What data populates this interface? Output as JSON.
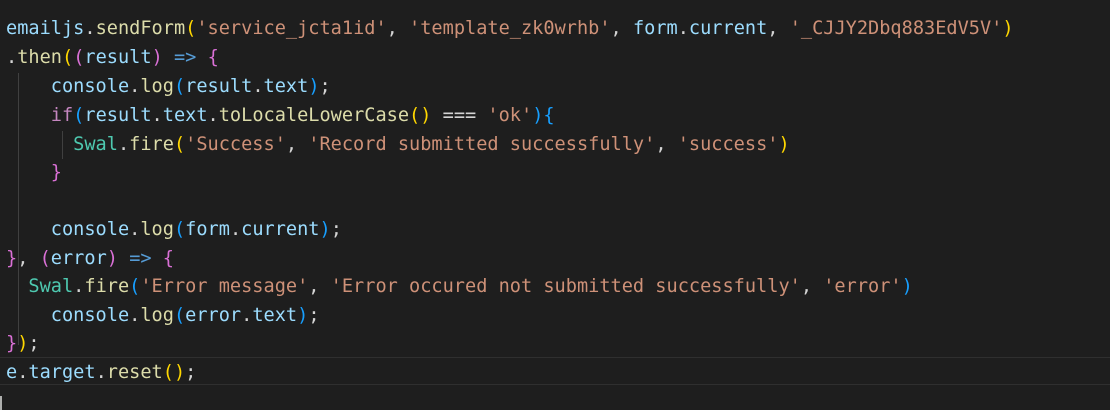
{
  "editor": {
    "lines": [
      {
        "tokens": [
          {
            "text": "emailjs",
            "cls": "tok-var"
          },
          {
            "text": ".",
            "cls": "tok-op"
          },
          {
            "text": "sendForm",
            "cls": "tok-fn"
          },
          {
            "text": "(",
            "cls": "b1"
          },
          {
            "text": "'service_jcta1id'",
            "cls": "tok-str"
          },
          {
            "text": ", ",
            "cls": "tok-op"
          },
          {
            "text": "'template_zk0wrhb'",
            "cls": "tok-str"
          },
          {
            "text": ", ",
            "cls": "tok-op"
          },
          {
            "text": "form",
            "cls": "tok-var"
          },
          {
            "text": ".",
            "cls": "tok-op"
          },
          {
            "text": "current",
            "cls": "tok-var"
          },
          {
            "text": ", ",
            "cls": "tok-op"
          },
          {
            "text": "'_CJJY2Dbq883EdV5V'",
            "cls": "tok-str"
          },
          {
            "text": ")",
            "cls": "b1"
          }
        ]
      },
      {
        "tokens": [
          {
            "text": ".",
            "cls": "tok-op"
          },
          {
            "text": "then",
            "cls": "tok-fn"
          },
          {
            "text": "(",
            "cls": "b1"
          },
          {
            "text": "(",
            "cls": "b2"
          },
          {
            "text": "result",
            "cls": "tok-var"
          },
          {
            "text": ")",
            "cls": "b2"
          },
          {
            "text": " ",
            "cls": "tok-op"
          },
          {
            "text": "=>",
            "cls": "tok-arrow"
          },
          {
            "text": " ",
            "cls": "tok-op"
          },
          {
            "text": "{",
            "cls": "b2"
          }
        ]
      },
      {
        "tokens": [
          {
            "text": "    ",
            "cls": "tok-op"
          },
          {
            "text": "console",
            "cls": "tok-var"
          },
          {
            "text": ".",
            "cls": "tok-op"
          },
          {
            "text": "log",
            "cls": "tok-fn"
          },
          {
            "text": "(",
            "cls": "b3"
          },
          {
            "text": "result",
            "cls": "tok-var"
          },
          {
            "text": ".",
            "cls": "tok-op"
          },
          {
            "text": "text",
            "cls": "tok-var"
          },
          {
            "text": ")",
            "cls": "b3"
          },
          {
            "text": ";",
            "cls": "tok-op"
          }
        ]
      },
      {
        "tokens": [
          {
            "text": "    ",
            "cls": "tok-op"
          },
          {
            "text": "if",
            "cls": "tok-kw"
          },
          {
            "text": "(",
            "cls": "b3"
          },
          {
            "text": "result",
            "cls": "tok-var"
          },
          {
            "text": ".",
            "cls": "tok-op"
          },
          {
            "text": "text",
            "cls": "tok-var"
          },
          {
            "text": ".",
            "cls": "tok-op"
          },
          {
            "text": "toLocaleLowerCase",
            "cls": "tok-fn"
          },
          {
            "text": "()",
            "cls": "b1"
          },
          {
            "text": " === ",
            "cls": "tok-op"
          },
          {
            "text": "'ok'",
            "cls": "tok-str"
          },
          {
            "text": ")",
            "cls": "b3"
          },
          {
            "text": "{",
            "cls": "b3"
          }
        ]
      },
      {
        "tokens": [
          {
            "text": "      ",
            "cls": "tok-op"
          },
          {
            "text": "Swal",
            "cls": "tok-cls"
          },
          {
            "text": ".",
            "cls": "tok-op"
          },
          {
            "text": "fire",
            "cls": "tok-fn"
          },
          {
            "text": "(",
            "cls": "b1"
          },
          {
            "text": "'Success'",
            "cls": "tok-str"
          },
          {
            "text": ", ",
            "cls": "tok-op"
          },
          {
            "text": "'Record submitted successfully'",
            "cls": "tok-str"
          },
          {
            "text": ", ",
            "cls": "tok-op"
          },
          {
            "text": "'success'",
            "cls": "tok-str"
          },
          {
            "text": ")",
            "cls": "b1"
          }
        ]
      },
      {
        "tokens": [
          {
            "text": "    ",
            "cls": "tok-op"
          },
          {
            "text": "}",
            "cls": "b2"
          }
        ]
      },
      {
        "tokens": []
      },
      {
        "tokens": [
          {
            "text": "    ",
            "cls": "tok-op"
          },
          {
            "text": "console",
            "cls": "tok-var"
          },
          {
            "text": ".",
            "cls": "tok-op"
          },
          {
            "text": "log",
            "cls": "tok-fn"
          },
          {
            "text": "(",
            "cls": "b3"
          },
          {
            "text": "form",
            "cls": "tok-var"
          },
          {
            "text": ".",
            "cls": "tok-op"
          },
          {
            "text": "current",
            "cls": "tok-var"
          },
          {
            "text": ")",
            "cls": "b3"
          },
          {
            "text": ";",
            "cls": "tok-op"
          }
        ]
      },
      {
        "tokens": [
          {
            "text": "}",
            "cls": "b2"
          },
          {
            "text": ", ",
            "cls": "tok-op"
          },
          {
            "text": "(",
            "cls": "b2"
          },
          {
            "text": "error",
            "cls": "tok-var"
          },
          {
            "text": ")",
            "cls": "b2"
          },
          {
            "text": " ",
            "cls": "tok-op"
          },
          {
            "text": "=>",
            "cls": "tok-arrow"
          },
          {
            "text": " ",
            "cls": "tok-op"
          },
          {
            "text": "{",
            "cls": "b2"
          }
        ]
      },
      {
        "tokens": [
          {
            "text": "  ",
            "cls": "tok-op"
          },
          {
            "text": "Swal",
            "cls": "tok-cls"
          },
          {
            "text": ".",
            "cls": "tok-op"
          },
          {
            "text": "fire",
            "cls": "tok-fn"
          },
          {
            "text": "(",
            "cls": "b3"
          },
          {
            "text": "'Error message'",
            "cls": "tok-str"
          },
          {
            "text": ", ",
            "cls": "tok-op"
          },
          {
            "text": "'Error occured not submitted successfully'",
            "cls": "tok-str"
          },
          {
            "text": ", ",
            "cls": "tok-op"
          },
          {
            "text": "'error'",
            "cls": "tok-str"
          },
          {
            "text": ")",
            "cls": "b3"
          }
        ]
      },
      {
        "tokens": [
          {
            "text": "    ",
            "cls": "tok-op"
          },
          {
            "text": "console",
            "cls": "tok-var"
          },
          {
            "text": ".",
            "cls": "tok-op"
          },
          {
            "text": "log",
            "cls": "tok-fn"
          },
          {
            "text": "(",
            "cls": "b3"
          },
          {
            "text": "error",
            "cls": "tok-var"
          },
          {
            "text": ".",
            "cls": "tok-op"
          },
          {
            "text": "text",
            "cls": "tok-var"
          },
          {
            "text": ")",
            "cls": "b3"
          },
          {
            "text": ";",
            "cls": "tok-op"
          }
        ]
      },
      {
        "tokens": [
          {
            "text": "}",
            "cls": "b2"
          },
          {
            "text": ")",
            "cls": "b1"
          },
          {
            "text": ";",
            "cls": "tok-op"
          }
        ]
      },
      {
        "tokens": [
          {
            "text": "e",
            "cls": "tok-var"
          },
          {
            "text": ".",
            "cls": "tok-op"
          },
          {
            "text": "target",
            "cls": "tok-var"
          },
          {
            "text": ".",
            "cls": "tok-op"
          },
          {
            "text": "reset",
            "cls": "tok-fn"
          },
          {
            "text": "()",
            "cls": "b1"
          },
          {
            "text": ";",
            "cls": "tok-op"
          }
        ]
      }
    ]
  }
}
